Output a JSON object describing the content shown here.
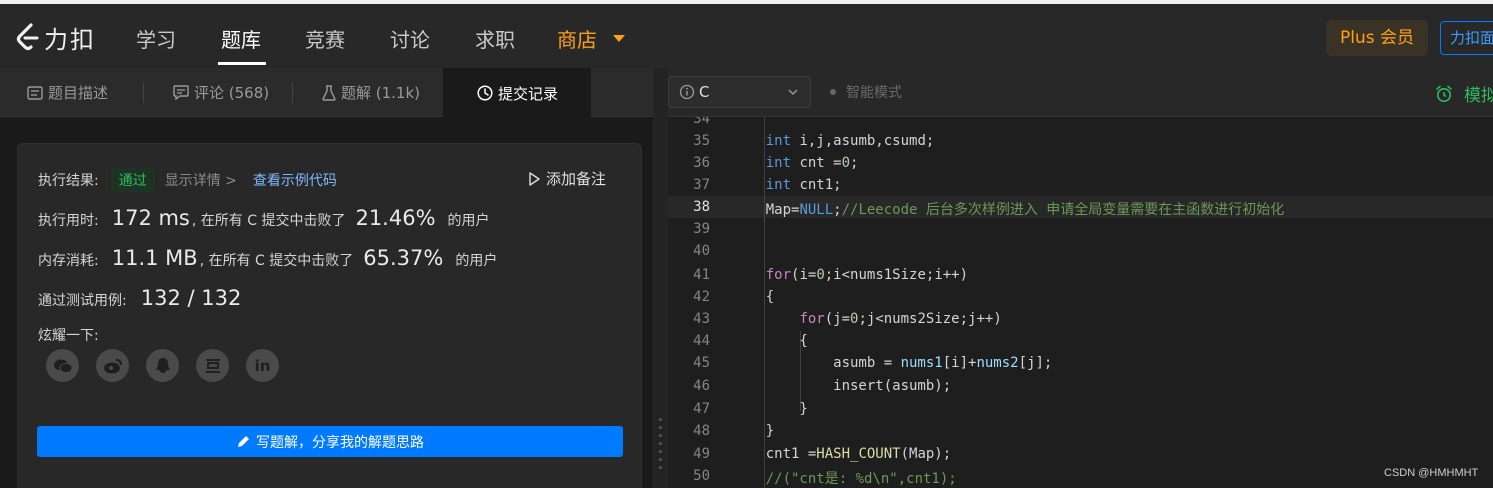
{
  "nav": {
    "logo_text": "力扣",
    "items": [
      "学习",
      "题库",
      "竞赛",
      "讨论",
      "求职",
      "商店"
    ],
    "plus_label": "Plus 会员",
    "face_label": "力扣面试"
  },
  "tabs": [
    {
      "label": "题目描述",
      "icon": "description-icon"
    },
    {
      "label": "评论 (568)",
      "icon": "comment-icon"
    },
    {
      "label": "题解 (1.1k)",
      "icon": "flask-icon"
    },
    {
      "label": "提交记录",
      "icon": "clock-icon"
    }
  ],
  "result": {
    "status_label": "执行结果:",
    "status_value": "通过",
    "details_link": "显示详情 >",
    "sample_link": "查看示例代码",
    "add_note": "添加备注",
    "runtime_label": "执行用时:",
    "runtime_value": "172 ms",
    "runtime_middle": ", 在所有 C 提交中击败了",
    "runtime_percent": "21.46%",
    "runtime_suffix": "的用户",
    "memory_label": "内存消耗:",
    "memory_value": "11.1 MB",
    "memory_middle": ", 在所有 C 提交中击败了",
    "memory_percent": "65.37%",
    "memory_suffix": "的用户",
    "tests_label": "通过测试用例:",
    "tests_value": "132 / 132",
    "share_label": "炫耀一下:",
    "share_icons": [
      "wechat-icon",
      "weibo-icon",
      "qq-icon",
      "douban-icon",
      "linkedin-icon"
    ],
    "write_button": "写题解，分享我的解题思路"
  },
  "editor_header": {
    "language": "C",
    "smart_mode": "智能模式",
    "mock_label": "模拟面试"
  },
  "code_lines": [
    {
      "n": "34",
      "text": ""
    },
    {
      "n": "35",
      "text": "    int i,j,asumb,csumd;"
    },
    {
      "n": "36",
      "text": "    int cnt =0;"
    },
    {
      "n": "37",
      "text": "    int cnt1;"
    },
    {
      "n": "38",
      "text": "    Map=NULL;//Leecode 后台多次样例进入 申请全局变量需要在主函数进行初始化"
    },
    {
      "n": "39",
      "text": ""
    },
    {
      "n": "40",
      "text": ""
    },
    {
      "n": "41",
      "text": "    for(i=0;i<nums1Size;i++)"
    },
    {
      "n": "42",
      "text": "    {"
    },
    {
      "n": "43",
      "text": "        for(j=0;j<nums2Size;j++)"
    },
    {
      "n": "44",
      "text": "        {"
    },
    {
      "n": "45",
      "text": "            asumb = nums1[i]+nums2[j];"
    },
    {
      "n": "46",
      "text": "            insert(asumb);"
    },
    {
      "n": "47",
      "text": "        }"
    },
    {
      "n": "48",
      "text": "    }"
    },
    {
      "n": "49",
      "text": "    cnt1 =HASH_COUNT(Map);"
    },
    {
      "n": "50",
      "text": "    //(\"cnt是: %d\\n\",cnt1);"
    }
  ],
  "watermark": "CSDN @HMHMHT",
  "colors": {
    "accent_orange": "#ffa116",
    "success_green": "#2cbb5d",
    "primary_blue": "#007aff"
  }
}
